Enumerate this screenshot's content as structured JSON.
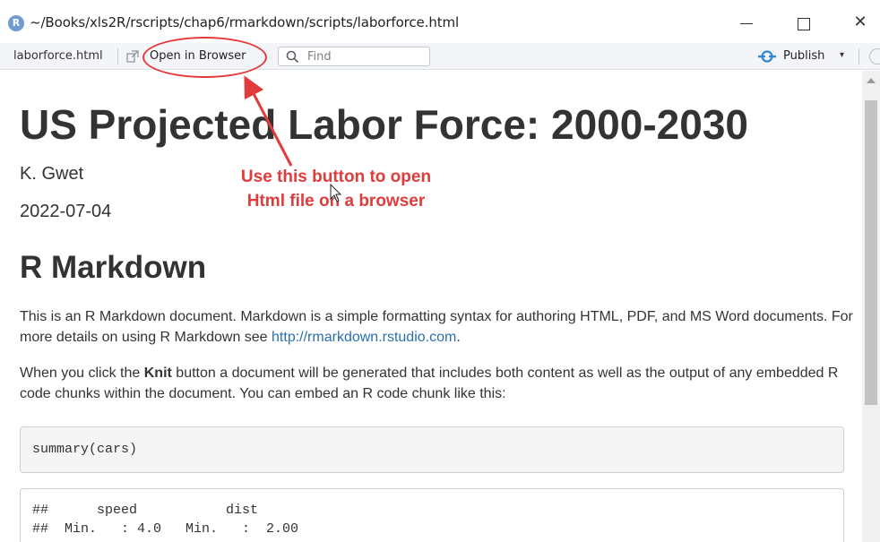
{
  "window": {
    "app_icon": "R",
    "title": "~/Books/xls2R/rscripts/chap6/rmarkdown/scripts/laborforce.html",
    "minimize_glyph": "—",
    "maximize_glyph": "□",
    "close_glyph": "✕"
  },
  "toolbar": {
    "file_name": "laborforce.html",
    "open_label": "Open in Browser",
    "find_placeholder": "Find",
    "publish_label": "Publish",
    "publish_caret": "▾",
    "icons": [
      "open-external-icon",
      "search-icon",
      "publish-icon",
      "refresh-icon"
    ]
  },
  "document": {
    "title": "US Projected Labor Force: 2000-2030",
    "author": "K. Gwet",
    "date": "2022-07-04",
    "heading": "R Markdown",
    "para1": {
      "text_before": "This is an R Markdown document. Markdown is a simple formatting syntax for authoring HTML, PDF, and MS Word documents. For more details on using R Markdown see ",
      "link_text": "http://rmarkdown.rstudio.com",
      "text_after": "."
    },
    "para2": {
      "text_before": "When you click the ",
      "bold_text": "Knit",
      "text_after": " button a document will be generated that includes both content as well as the output of any embedded R code chunks within the document. You can embed an R code chunk like this:"
    },
    "code_chunk": "summary(cars)",
    "output_lines": [
      "##      speed           dist",
      "##  Min.   : 4.0   Min.   :  2.00"
    ]
  },
  "annotation": {
    "line1": "Use this button to open",
    "line2": "Html file on a browser",
    "color": "#e23b3b"
  }
}
